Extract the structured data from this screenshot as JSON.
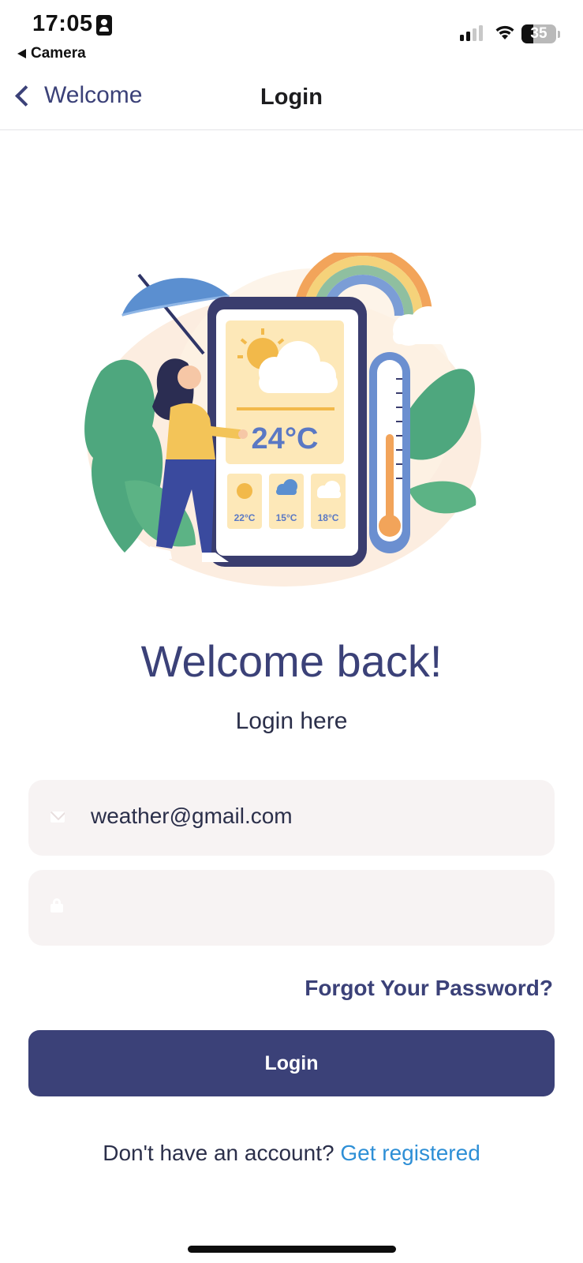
{
  "status_bar": {
    "time": "17:05",
    "back_app": "Camera",
    "battery": "35",
    "battery_level": 0.35,
    "icons": [
      "person-badge-icon",
      "cellular-signal-icon",
      "wifi-icon",
      "battery-icon"
    ]
  },
  "nav": {
    "back_label": "Welcome",
    "title": "Login"
  },
  "illustration": {
    "main_temp": "24°C",
    "forecast": [
      "22°C",
      "15°C",
      "18°C"
    ]
  },
  "headline": "Welcome back!",
  "subheadline": "Login here",
  "email": {
    "value": "weather@gmail.com",
    "icon": "mail-icon"
  },
  "password": {
    "value": "",
    "icon": "lock-icon"
  },
  "forgot_password": "Forgot Your Password?",
  "login_button": "Login",
  "register": {
    "prompt": "Don't have an account?",
    "link": "Get registered"
  },
  "colors": {
    "primary": "#3b4178",
    "link": "#2e8fd6",
    "field_bg": "#f7f3f3"
  }
}
